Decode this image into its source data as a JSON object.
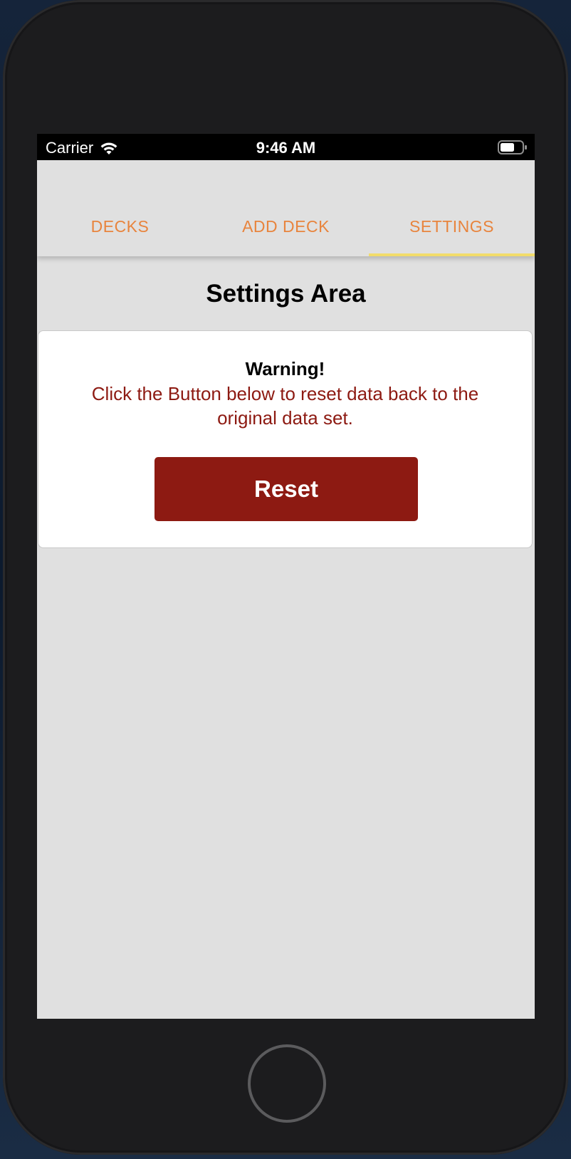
{
  "status_bar": {
    "carrier": "Carrier",
    "time": "9:46 AM",
    "wifi_icon": "wifi-icon",
    "battery_icon": "battery-icon"
  },
  "tabs": [
    {
      "label": "DECKS",
      "active": false
    },
    {
      "label": "ADD DECK",
      "active": false
    },
    {
      "label": "SETTINGS",
      "active": true
    }
  ],
  "settings": {
    "title": "Settings Area",
    "warning_title": "Warning!",
    "warning_text": "Click the Button below to reset data back to the original data set.",
    "reset_label": "Reset"
  },
  "colors": {
    "tab_text": "#e8843d",
    "tab_indicator": "#f2dc6b",
    "warning_text": "#8d1a12",
    "reset_button": "#8d1a12",
    "screen_background": "#e0e0e0"
  }
}
